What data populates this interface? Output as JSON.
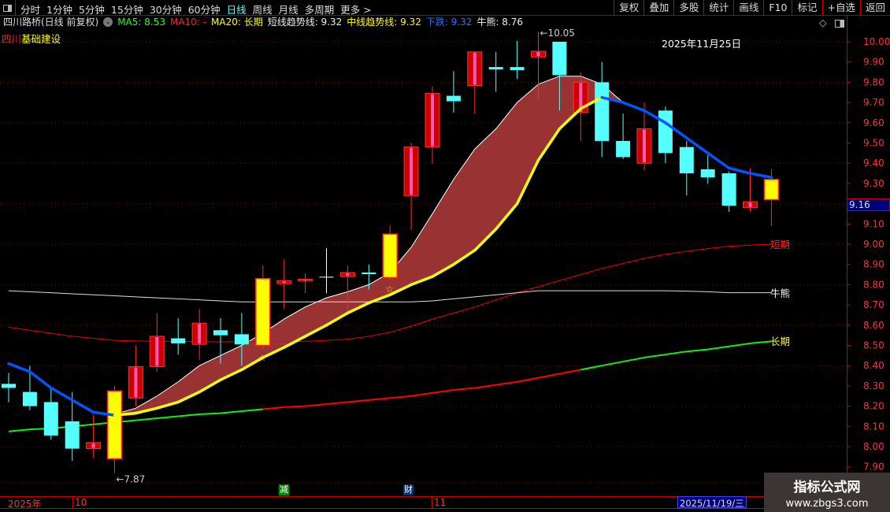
{
  "toolbar": {
    "periods": [
      "分时",
      "1分钟",
      "5分钟",
      "15分钟",
      "30分钟",
      "60分钟",
      "日线",
      "周线",
      "月线",
      "多周期",
      "更多 >"
    ],
    "active_period": "日线",
    "right_buttons": [
      "复权",
      "叠加",
      "多股",
      "统计",
      "画线",
      "F10",
      "标记",
      "+自选",
      "返回"
    ]
  },
  "info": {
    "title": "四川路桥(日线 前复权)",
    "ma5": "MA5: 8.53",
    "ma10": "MA10: -",
    "ma20": "MA20: 长期",
    "short_trend": "短线趋势线: 9.32",
    "mid_trend": "中线趋势线: 9.32",
    "fall": "下跌: 9.32",
    "bull_bear": "牛熊: 8.76"
  },
  "sector_label_a": "四川",
  "sector_label_b": "基础建设",
  "date_stamp": "2025年11月25日",
  "current_price_tag": "9.16",
  "line_labels": {
    "short": "短期",
    "bullbear": "牛熊",
    "long": "长期"
  },
  "date_axis": {
    "year": "2025年",
    "m10": "10",
    "m11": "11",
    "cursor_date": "2025/11/19/三"
  },
  "event_marks": {
    "reduce": "减",
    "finance": "财"
  },
  "watermark": {
    "name": "指标公式网",
    "url": "www.zbgs3.com"
  },
  "colors": {
    "up": "#ff2020",
    "down": "#55ffff",
    "special": "#ffff00",
    "band": "#993333",
    "fall": "#0055ff"
  },
  "chart_data": {
    "type": "candlestick",
    "ylim": [
      7.85,
      10.07
    ],
    "y_ticks": [
      "10.00",
      "9.90",
      "9.80",
      "9.70",
      "9.60",
      "9.50",
      "9.40",
      "9.30",
      "9.20",
      "9.10",
      "9.00",
      "8.90",
      "8.80",
      "8.70",
      "8.60",
      "8.50",
      "8.40",
      "8.30",
      "8.20",
      "8.10",
      "8.00",
      "7.90"
    ],
    "high_label": "←10.05",
    "low_label": "←7.87",
    "candles": [
      [
        8.31,
        8.365,
        8.22,
        8.29,
        "down"
      ],
      [
        8.27,
        8.4,
        8.18,
        8.2,
        "down"
      ],
      [
        8.22,
        8.29,
        8.035,
        8.055,
        "down"
      ],
      [
        8.125,
        8.27,
        7.93,
        7.99,
        "down"
      ],
      [
        7.99,
        8.157,
        7.945,
        8.02,
        "up"
      ],
      [
        7.94,
        8.3,
        7.87,
        8.275,
        "special"
      ],
      [
        8.24,
        8.5,
        8.2,
        8.395,
        "up"
      ],
      [
        8.395,
        8.66,
        8.37,
        8.545,
        "up"
      ],
      [
        8.535,
        8.635,
        8.455,
        8.51,
        "down"
      ],
      [
        8.505,
        8.68,
        8.43,
        8.61,
        "up"
      ],
      [
        8.575,
        8.635,
        8.41,
        8.55,
        "down"
      ],
      [
        8.555,
        8.66,
        8.4,
        8.505,
        "down"
      ],
      [
        8.5,
        8.895,
        8.485,
        8.83,
        "special"
      ],
      [
        8.805,
        8.925,
        8.68,
        8.82,
        "up"
      ],
      [
        8.82,
        8.855,
        8.757,
        8.827,
        "up"
      ],
      [
        8.837,
        8.98,
        8.757,
        8.837,
        "doji"
      ],
      [
        8.84,
        8.895,
        8.66,
        8.86,
        "up"
      ],
      [
        8.86,
        8.9,
        8.776,
        8.852,
        "down"
      ],
      [
        8.835,
        9.094,
        8.824,
        9.05,
        "special"
      ],
      [
        9.24,
        9.5,
        9.07,
        9.48,
        "up"
      ],
      [
        9.48,
        9.78,
        9.396,
        9.745,
        "up"
      ],
      [
        9.733,
        9.855,
        9.65,
        9.706,
        "down"
      ],
      [
        9.784,
        9.95,
        9.643,
        9.95,
        "up"
      ],
      [
        9.875,
        9.95,
        9.753,
        9.863,
        "down"
      ],
      [
        9.875,
        10.004,
        9.816,
        9.86,
        "down"
      ],
      [
        9.925,
        10.05,
        9.72,
        9.953,
        "up"
      ],
      [
        10.0,
        10.0,
        9.66,
        9.835,
        "down"
      ],
      [
        9.65,
        9.85,
        9.51,
        9.8,
        "up"
      ],
      [
        9.8,
        9.9,
        9.43,
        9.51,
        "down"
      ],
      [
        9.51,
        9.645,
        9.42,
        9.43,
        "down"
      ],
      [
        9.4,
        9.7,
        9.365,
        9.57,
        "up"
      ],
      [
        9.66,
        9.68,
        9.4,
        9.45,
        "down"
      ],
      [
        9.48,
        9.51,
        9.24,
        9.35,
        "down"
      ],
      [
        9.37,
        9.44,
        9.3,
        9.33,
        "down"
      ],
      [
        9.35,
        9.36,
        9.16,
        9.19,
        "down"
      ],
      [
        9.18,
        9.376,
        9.16,
        9.21,
        "up"
      ],
      [
        9.22,
        9.37,
        9.09,
        9.32,
        "special"
      ]
    ],
    "series": [
      {
        "name": "短线趋势线",
        "values": [
          8.41,
          8.37,
          8.29,
          8.23,
          8.17,
          8.155,
          8.165,
          8.19,
          8.22,
          8.27,
          8.33,
          8.38,
          8.44,
          8.49,
          8.545,
          8.6,
          8.66,
          8.71,
          8.75,
          8.8,
          8.84,
          8.9,
          8.97,
          9.075,
          9.2,
          9.415,
          9.57,
          9.67,
          9.725,
          9.7,
          9.66,
          9.6,
          9.525,
          9.45,
          9.376,
          9.35,
          9.33
        ]
      },
      {
        "name": "中线趋势线",
        "values": [
          null,
          null,
          null,
          null,
          null,
          8.16,
          8.19,
          8.25,
          8.32,
          8.4,
          8.45,
          8.5,
          8.56,
          8.63,
          8.69,
          8.735,
          8.765,
          8.8,
          8.86,
          8.985,
          9.15,
          9.32,
          9.47,
          9.57,
          9.7,
          9.79,
          9.83,
          9.83,
          9.79,
          9.7,
          null,
          null,
          null,
          null,
          null,
          null,
          null
        ]
      },
      {
        "name": "短期",
        "values": [
          8.59,
          8.575,
          8.56,
          8.545,
          8.535,
          8.525,
          8.522,
          8.52,
          8.52,
          8.518,
          8.518,
          8.518,
          8.52,
          8.52,
          8.52,
          8.525,
          8.53,
          8.545,
          8.565,
          8.595,
          8.63,
          8.66,
          8.69,
          8.725,
          8.76,
          8.79,
          8.82,
          8.85,
          8.88,
          8.905,
          8.93,
          8.95,
          8.965,
          8.978,
          8.99,
          8.995,
          9.0
        ]
      },
      {
        "name": "牛熊",
        "values": [
          8.77,
          8.765,
          8.76,
          8.755,
          8.75,
          8.745,
          8.74,
          8.735,
          8.73,
          8.725,
          8.72,
          8.715,
          8.715,
          8.715,
          8.715,
          8.715,
          8.715,
          8.715,
          8.715,
          8.715,
          8.72,
          8.73,
          8.74,
          8.75,
          8.76,
          8.77,
          8.77,
          8.77,
          8.77,
          8.77,
          8.77,
          8.77,
          8.768,
          8.765,
          8.76,
          8.76,
          8.76
        ]
      },
      {
        "name": "长期",
        "values": [
          8.075,
          8.085,
          8.09,
          8.1,
          8.11,
          8.12,
          8.13,
          8.14,
          8.15,
          8.16,
          8.165,
          8.175,
          8.185,
          8.195,
          8.2,
          8.21,
          8.22,
          8.23,
          8.24,
          8.25,
          8.265,
          8.28,
          8.29,
          8.305,
          8.32,
          8.34,
          8.36,
          8.38,
          8.4,
          8.42,
          8.44,
          8.455,
          8.47,
          8.48,
          8.495,
          8.51,
          8.52
        ]
      }
    ],
    "star_marks": [
      12,
      18
    ]
  }
}
